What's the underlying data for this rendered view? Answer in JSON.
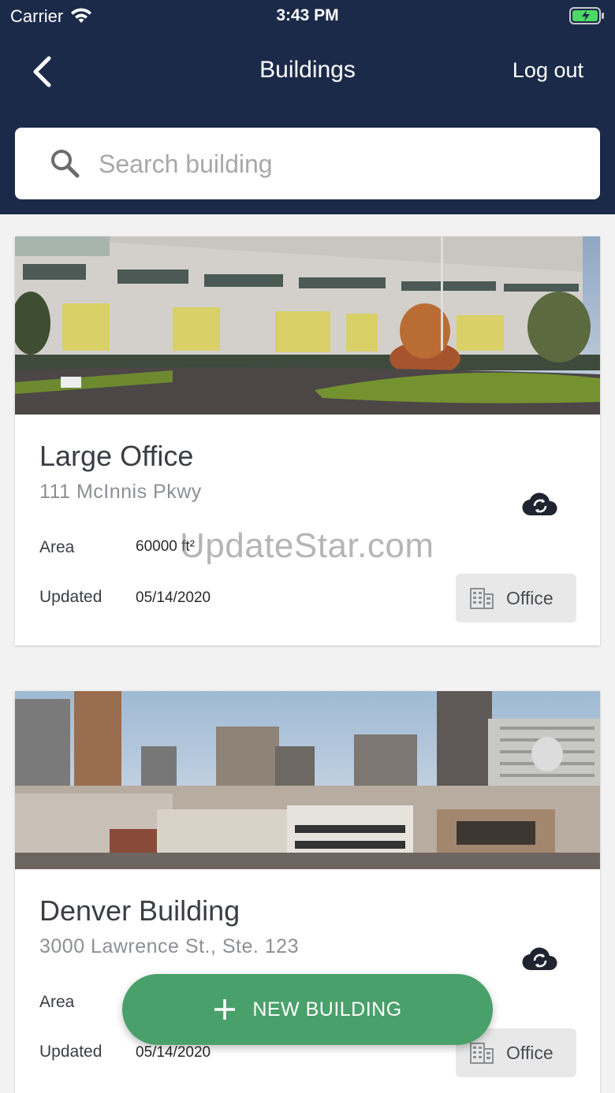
{
  "status_bar": {
    "carrier": "Carrier",
    "time": "3:43 PM"
  },
  "nav": {
    "title": "Buildings",
    "logout_label": "Log out"
  },
  "search": {
    "placeholder": "Search building"
  },
  "buildings": [
    {
      "name": "Large Office",
      "address": "111 McInnis Pkwy",
      "area_label": "Area",
      "area_value": "60000 ft²",
      "updated_label": "Updated",
      "updated_value": "05/14/2020",
      "type": "Office"
    },
    {
      "name": "Denver Building",
      "address": "3000 Lawrence St., Ste. 123",
      "area_label": "Area",
      "area_value": "",
      "updated_label": "Updated",
      "updated_value": "05/14/2020",
      "type": "Office"
    }
  ],
  "watermark": "UpdateStar.com",
  "fab": {
    "label": "NEW BUILDING"
  },
  "colors": {
    "header_bg": "#1c2a4a",
    "fab_green": "#4aa06a",
    "battery_green": "#4cd964"
  },
  "icons": [
    "back-icon",
    "search-icon",
    "sync-icon",
    "building-icon",
    "plus-icon",
    "wifi-icon",
    "battery-icon"
  ]
}
